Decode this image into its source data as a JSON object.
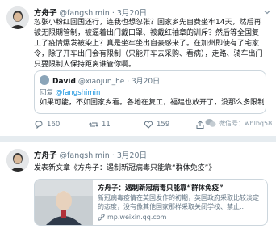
{
  "tweet1": {
    "author_name": "方舟子",
    "handle": "@fangshimin",
    "separator": "·",
    "date": "3月20日",
    "text": "忽张小粉红回国还行，连我也想忽张？回家乡先自费坐牢14天，然后再被无限期管制，被逼着出门戴口罩、被戴红袖章的训斥？然后等全国复工了疫情爆发被染上？真是坐牢坐出自豪感来了。在加州即使有了宅家令，除了开车出门会有限制（只能开车去采购、看病），走路、骑车出门只要限制人保持距离谁管你啊。",
    "quote": {
      "name": "David",
      "handle": "@xiaojun_he",
      "separator": "·",
      "date": "3月20日",
      "reply_prefix": "回复",
      "reply_mention": "@fangshimin",
      "text": "如果可能，不如回家乡看。各地在复工，福建也放开了，没那么多限制"
    },
    "actions": {
      "reply_count": "160",
      "retweet_count": "11",
      "like_count": "159"
    }
  },
  "watermark": {
    "text": "微信号：whlbq58"
  },
  "tweet2": {
    "author_name": "方舟子",
    "handle": "@fangshimin",
    "separator": "·",
    "date": "3月20日",
    "text": "发表新文章《方舟子：遏制新冠病毒只能靠“群体免疫”》",
    "card": {
      "title": "方舟子：遏制新冠病毒只能靠“群体免疫”",
      "description": "新冠病毒疫情在英国发作的初期，英国政府采取比较淡定的态度，没有像其他国家那样采取关闭学校、禁止...",
      "link": "mp.weixin.qq.com"
    }
  }
}
